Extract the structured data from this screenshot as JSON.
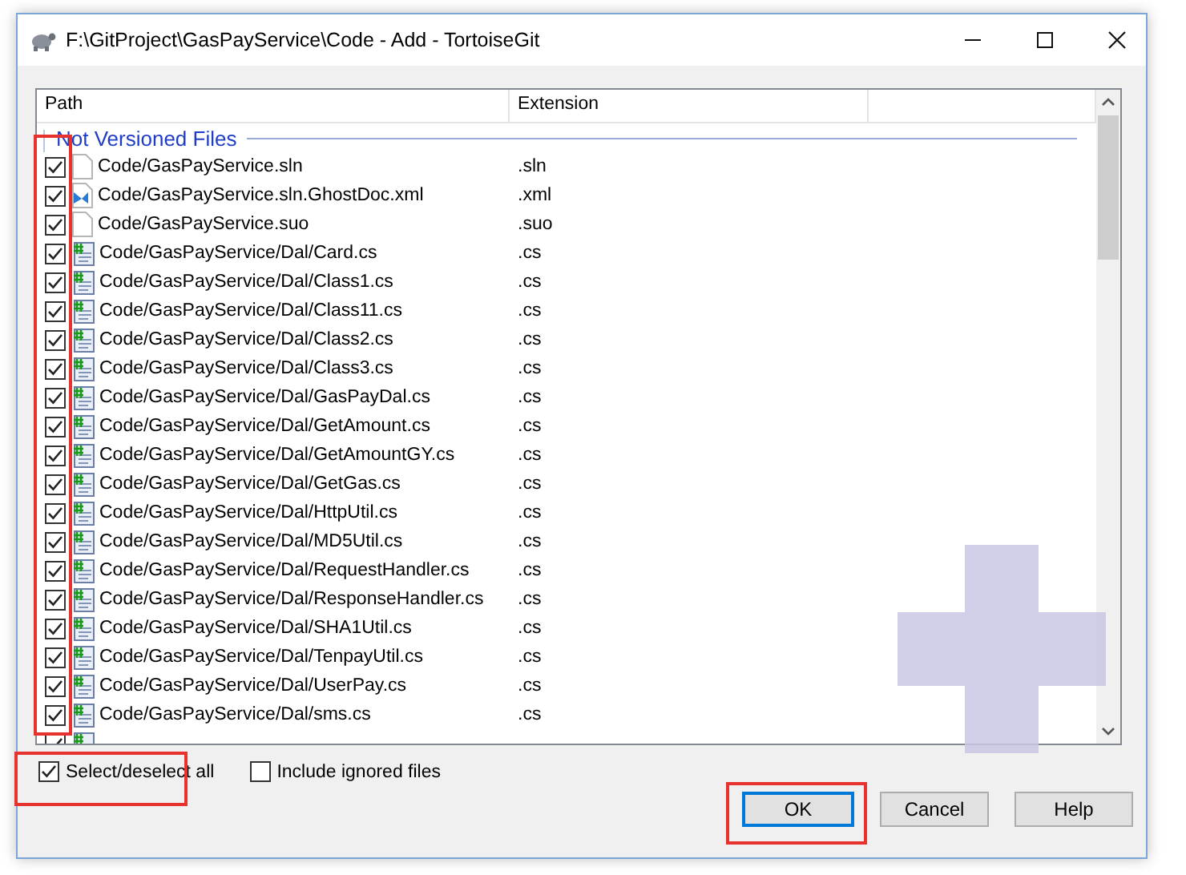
{
  "window": {
    "title": "F:\\GitProject\\GasPayService\\Code - Add - TortoiseGit"
  },
  "list": {
    "columns": [
      "Path",
      "Extension"
    ],
    "group": "Not Versioned Files",
    "rows": [
      {
        "path": "Code/GasPayService.sln",
        "extension": ".sln",
        "kind": "file",
        "checked": true
      },
      {
        "path": "Code/GasPayService.sln.GhostDoc.xml",
        "extension": ".xml",
        "kind": "xml",
        "checked": true
      },
      {
        "path": "Code/GasPayService.suo",
        "extension": ".suo",
        "kind": "file",
        "checked": true
      },
      {
        "path": "Code/GasPayService/Dal/Card.cs",
        "extension": ".cs",
        "kind": "cs",
        "checked": true
      },
      {
        "path": "Code/GasPayService/Dal/Class1.cs",
        "extension": ".cs",
        "kind": "cs",
        "checked": true
      },
      {
        "path": "Code/GasPayService/Dal/Class11.cs",
        "extension": ".cs",
        "kind": "cs",
        "checked": true
      },
      {
        "path": "Code/GasPayService/Dal/Class2.cs",
        "extension": ".cs",
        "kind": "cs",
        "checked": true
      },
      {
        "path": "Code/GasPayService/Dal/Class3.cs",
        "extension": ".cs",
        "kind": "cs",
        "checked": true
      },
      {
        "path": "Code/GasPayService/Dal/GasPayDal.cs",
        "extension": ".cs",
        "kind": "cs",
        "checked": true
      },
      {
        "path": "Code/GasPayService/Dal/GetAmount.cs",
        "extension": ".cs",
        "kind": "cs",
        "checked": true
      },
      {
        "path": "Code/GasPayService/Dal/GetAmountGY.cs",
        "extension": ".cs",
        "kind": "cs",
        "checked": true
      },
      {
        "path": "Code/GasPayService/Dal/GetGas.cs",
        "extension": ".cs",
        "kind": "cs",
        "checked": true
      },
      {
        "path": "Code/GasPayService/Dal/HttpUtil.cs",
        "extension": ".cs",
        "kind": "cs",
        "checked": true
      },
      {
        "path": "Code/GasPayService/Dal/MD5Util.cs",
        "extension": ".cs",
        "kind": "cs",
        "checked": true
      },
      {
        "path": "Code/GasPayService/Dal/RequestHandler.cs",
        "extension": ".cs",
        "kind": "cs",
        "checked": true
      },
      {
        "path": "Code/GasPayService/Dal/ResponseHandler.cs",
        "extension": ".cs",
        "kind": "cs",
        "checked": true
      },
      {
        "path": "Code/GasPayService/Dal/SHA1Util.cs",
        "extension": ".cs",
        "kind": "cs",
        "checked": true
      },
      {
        "path": "Code/GasPayService/Dal/TenpayUtil.cs",
        "extension": ".cs",
        "kind": "cs",
        "checked": true
      },
      {
        "path": "Code/GasPayService/Dal/UserPay.cs",
        "extension": ".cs",
        "kind": "cs",
        "checked": true
      },
      {
        "path": "Code/GasPayService/Dal/sms.cs",
        "extension": ".cs",
        "kind": "cs",
        "checked": true
      }
    ],
    "partial_row": {
      "kind": "cs",
      "checked": true
    }
  },
  "options": [
    {
      "label": "Select/deselect all",
      "checked": true
    },
    {
      "label": "Include ignored files",
      "checked": false
    }
  ],
  "buttons": [
    {
      "label": "OK",
      "selected": true
    },
    {
      "label": "Cancel",
      "selected": false
    },
    {
      "label": "Help",
      "selected": false
    }
  ],
  "highlights": [
    {
      "kind": "checkbox-column"
    },
    {
      "kind": "select-all"
    },
    {
      "kind": "ok-button"
    }
  ]
}
